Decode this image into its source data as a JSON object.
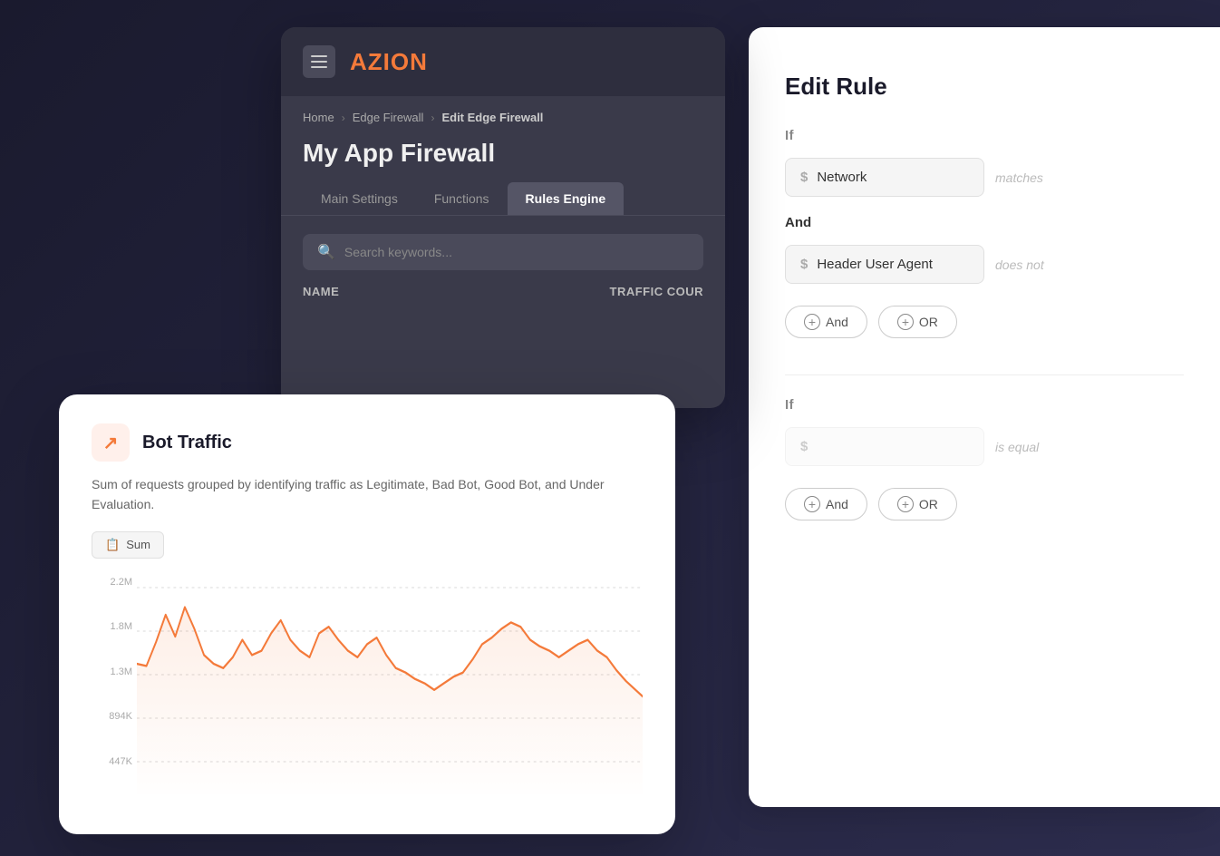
{
  "editRule": {
    "title": "Edit Rule",
    "section1": {
      "label": "If",
      "field1": {
        "dollarSign": "$",
        "value": "Network",
        "operator": "matches"
      },
      "andLabel": "And",
      "field2": {
        "dollarSign": "$",
        "value": "Header User Agent",
        "operator": "does not"
      }
    },
    "buttons": {
      "and": "And",
      "or": "OR"
    },
    "section2": {
      "label": "If",
      "field1": {
        "dollarSign": "$",
        "operator": "is equal"
      }
    },
    "buttons2": {
      "and": "And",
      "or": "OR"
    }
  },
  "mainApp": {
    "logoText": "AZION",
    "breadcrumb": {
      "home": "Home",
      "edgeFirewall": "Edge Firewall",
      "editFirewall": "Edit Edge Firewall"
    },
    "pageTitle": "My App Firewall",
    "tabs": [
      {
        "label": "Main Settings",
        "active": false
      },
      {
        "label": "Functions",
        "active": false
      },
      {
        "label": "Rules Engine",
        "active": true
      }
    ],
    "search": {
      "placeholder": "Search keywords..."
    },
    "table": {
      "nameCol": "Name",
      "trafficCol": "Traffic Cour"
    }
  },
  "botTrafficCard": {
    "title": "Bot Traffic",
    "description": "Sum of requests grouped by identifying traffic as Legitimate, Bad Bot, Good Bot, and Under Evaluation.",
    "badge": "Sum",
    "chart": {
      "yLabels": [
        "2.2M",
        "1.8M",
        "1.3M",
        "894K",
        "447K"
      ],
      "dataPoints": [
        180,
        175,
        210,
        240,
        220,
        250,
        230,
        200,
        190,
        185,
        195,
        210,
        195,
        200,
        215,
        225,
        210,
        200,
        195,
        215,
        220,
        210,
        200,
        195,
        205,
        210,
        195,
        185,
        180,
        175,
        170,
        165,
        170,
        175,
        180,
        190,
        200,
        205,
        210,
        215,
        220,
        210,
        205,
        200,
        195,
        200,
        205,
        210,
        200,
        195,
        185,
        175
      ]
    }
  },
  "colors": {
    "accent": "#f47a3a",
    "accentLight": "#fff0eb",
    "appBg": "#2e2e3e",
    "panelBg": "#3a3a4a",
    "white": "#ffffff"
  }
}
